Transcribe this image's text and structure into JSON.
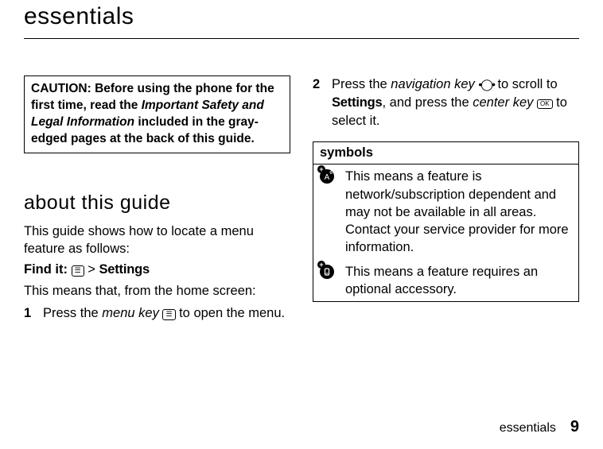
{
  "page": {
    "title": "essentials",
    "footer_label": "essentials",
    "page_number": "9"
  },
  "caution": {
    "prefix": "CAUTION: Before using the phone for the first time, read the ",
    "italic": "Important Safety and Legal Information",
    "suffix": " included in the gray-edged pages at the back of this guide."
  },
  "about": {
    "heading": "about this guide",
    "intro": "This guide shows how to locate a menu feature as follows:",
    "find_label": "Find it:",
    "find_sep": " > ",
    "find_target": "Settings",
    "means": "This means that, from the home screen:"
  },
  "steps": [
    {
      "num": "1",
      "pre": "Press the ",
      "key_label": "menu key",
      "post": " to open the menu."
    },
    {
      "num": "2",
      "pre": "Press the ",
      "key1_label": "navigation key",
      "mid1": " to scroll to ",
      "target": "Settings",
      "mid2": ", and press the ",
      "key2_label": "center key",
      "post": " to select it."
    }
  ],
  "symbols": {
    "header": "symbols",
    "rows": [
      {
        "icon": "network-dependent-icon",
        "text": "This means a feature is network/subscription dependent and may not be available in all areas. Contact your service provider for more information."
      },
      {
        "icon": "accessory-required-icon",
        "text": "This means a feature requires an optional accessory."
      }
    ]
  }
}
